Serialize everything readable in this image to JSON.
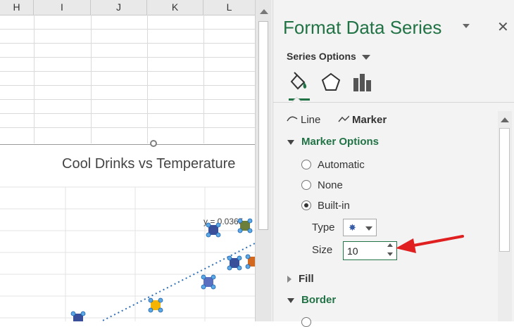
{
  "sheet": {
    "columns": [
      "H",
      "I",
      "J",
      "K",
      "L"
    ]
  },
  "chart": {
    "title": "Cool Drinks vs Temperature",
    "trendline_label": "y = 0.0365",
    "marker_colors": [
      "#3a4f9a",
      "#5a6fbf",
      "#f5b400",
      "#d2691e",
      "#6b7f3a"
    ]
  },
  "panel": {
    "title": "Format Data Series",
    "close": "✕",
    "series_options": "Series Options",
    "subtabs": {
      "line": "Line",
      "marker": "Marker"
    },
    "marker_options": "Marker Options",
    "radios": [
      {
        "label": "Automatic",
        "selected": false
      },
      {
        "label": "None",
        "selected": false
      },
      {
        "label": "Built-in",
        "selected": true
      }
    ],
    "type_label": "Type",
    "type_marker": "✸",
    "size_label": "Size",
    "size_value": "10",
    "fill": "Fill",
    "border": "Border"
  },
  "colors": {
    "accent": "#217346",
    "arrow": "#e02020"
  }
}
